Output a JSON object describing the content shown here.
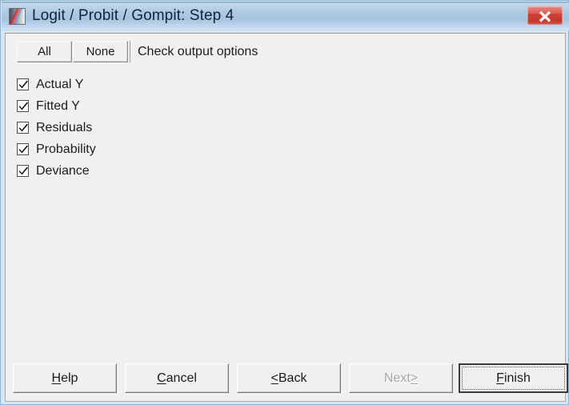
{
  "window": {
    "title": "Logit / Probit / Gompit: Step 4",
    "icon": "app-gradient-icon",
    "close_icon": "close-x-icon",
    "close_label": "Close"
  },
  "toolbar": {
    "all_label": "All",
    "none_label": "None",
    "instruction": "Check output options"
  },
  "options": [
    {
      "label": "Actual Y",
      "checked": true
    },
    {
      "label": "Fitted Y",
      "checked": true
    },
    {
      "label": "Residuals",
      "checked": true
    },
    {
      "label": "Probability",
      "checked": true
    },
    {
      "label": "Deviance",
      "checked": true
    }
  ],
  "buttons": {
    "help": {
      "accel": "H",
      "rest": "elp",
      "prefix": "",
      "enabled": true,
      "default": false
    },
    "cancel": {
      "accel": "C",
      "rest": "ancel",
      "prefix": "",
      "enabled": true,
      "default": false
    },
    "back": {
      "accel": "<",
      "rest": " Back",
      "prefix": "",
      "enabled": true,
      "default": false
    },
    "next": {
      "accel": ">",
      "rest": "",
      "prefix": "Next ",
      "enabled": false,
      "default": false
    },
    "finish": {
      "accel": "F",
      "rest": "inish",
      "prefix": "",
      "enabled": true,
      "default": true
    }
  },
  "colors": {
    "titlebar_top": "#8aa8c4",
    "titlebar_body": "#aac6e0",
    "close_red": "#cf4035",
    "client_bg": "#f0f0f0",
    "frame_blue": "#8ab4d8",
    "text": "#1c1c1c",
    "disabled_text": "#a6a6a6"
  }
}
